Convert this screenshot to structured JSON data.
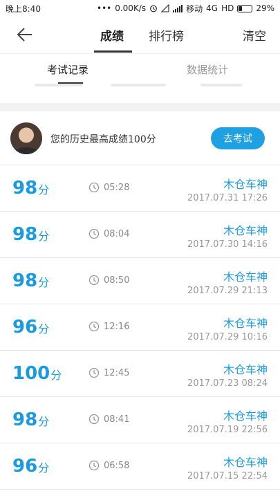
{
  "status_bar": {
    "time": "晚上8:40",
    "dots": "•••",
    "speed": "0.00K/s",
    "carrier": "移动",
    "network": "4G",
    "hd": "HD",
    "battery": "29%",
    "battery_level": 0.29
  },
  "navbar": {
    "back_icon": "arrow-left-icon",
    "tabs": [
      {
        "label": "成绩",
        "active": true
      },
      {
        "label": "排行榜",
        "active": false
      }
    ],
    "clear_label": "清空"
  },
  "subtabs": [
    {
      "label": "考试记录",
      "active": true
    },
    {
      "label": "数据统计",
      "active": false
    }
  ],
  "profile": {
    "best_text": "您的历史最高成绩100分",
    "go_button": "去考试"
  },
  "records": [
    {
      "score": "98",
      "unit": "分",
      "duration": "05:28",
      "name": "木仓车神",
      "date": "2017.07.31  17:26"
    },
    {
      "score": "98",
      "unit": "分",
      "duration": "08:04",
      "name": "木仓车神",
      "date": "2017.07.30  14:16"
    },
    {
      "score": "98",
      "unit": "分",
      "duration": "08:50",
      "name": "木仓车神",
      "date": "2017.07.29  21:13"
    },
    {
      "score": "96",
      "unit": "分",
      "duration": "12:16",
      "name": "木仓车神",
      "date": "2017.07.29  10:16"
    },
    {
      "score": "100",
      "unit": "分",
      "duration": "12:45",
      "name": "木仓车神",
      "date": "2017.07.23  08:24"
    },
    {
      "score": "98",
      "unit": "分",
      "duration": "08:41",
      "name": "木仓车神",
      "date": "2017.07.19  22:56"
    },
    {
      "score": "96",
      "unit": "分",
      "duration": "06:58",
      "name": "木仓车神",
      "date": "2017.07.15  22:54"
    }
  ],
  "colors": {
    "accent": "#1a9be0",
    "button": "#1da1e2"
  }
}
